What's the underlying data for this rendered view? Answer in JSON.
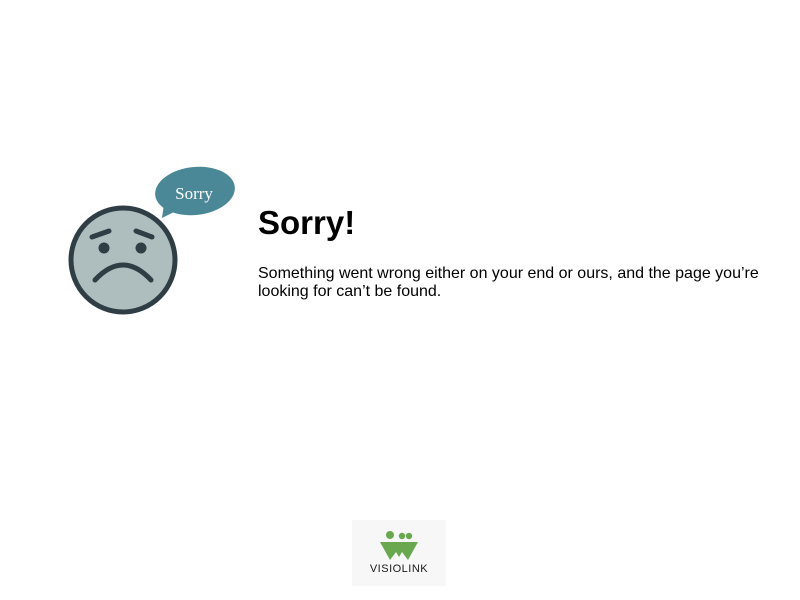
{
  "illustration": {
    "icon": "sad-face-icon",
    "bubble_text": "Sorry",
    "colors": {
      "face_fill": "#aebdbd",
      "face_outline": "#2f3d44",
      "bubble_fill": "#4a8797"
    }
  },
  "message": {
    "heading": "Sorry!",
    "body": "Something went wrong either on your end or ours, and the page you’re looking for can’t be found."
  },
  "footer": {
    "logo_icon": "visiolink-logo-icon",
    "brand_name": "VISIOLINK",
    "brand_color": "#6aa84f"
  }
}
